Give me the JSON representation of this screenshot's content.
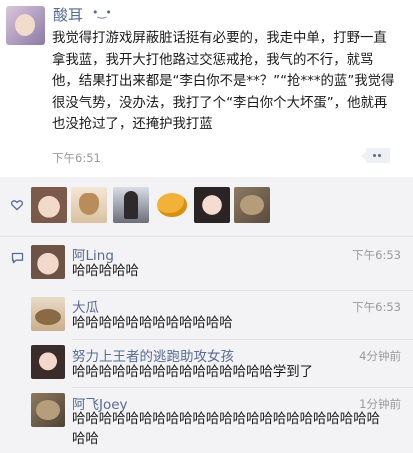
{
  "post": {
    "author": "酸耳",
    "author_decoration": "•‿•",
    "text": "我觉得打游戏屏蔽脏话挺有必要的，我走中单，打野一直拿我蓝，我开大打他路过交惩戒抢，我气的不行，就骂他，结果打出来都是“李白你不是**？”“抢***的蓝”我觉得很没气势，没办法，我打了个“李白你个大坏蛋”，他就再也没抢过了，还掩护我打蓝",
    "time": "下午6:51",
    "more_icon": "more-dots-icon"
  },
  "likes": {
    "icon": "heart-icon",
    "avatars": [
      "avatar-1",
      "avatar-2",
      "avatar-3",
      "avatar-4",
      "avatar-5",
      "avatar-6"
    ]
  },
  "comments_icon": "comment-icon",
  "comments": [
    {
      "name": "阿Ling",
      "time": "下午6:53",
      "text": "哈哈哈哈哈"
    },
    {
      "name": "大瓜",
      "time": "下午6:53",
      "text": "哈哈哈哈哈哈哈哈哈哈哈哈"
    },
    {
      "name": "努力上王者的逃跑助攻女孩",
      "time": "4分钟前",
      "text": "哈哈哈哈哈哈哈哈哈哈哈哈哈哈哈学到了"
    },
    {
      "name": "阿飞Joey",
      "time": "1分钟前",
      "text": "哈哈哈哈哈哈哈哈哈哈哈哈哈哈哈哈哈哈哈哈哈哈哈哈哈"
    }
  ],
  "colors": {
    "link": "#576b95",
    "meta": "#9a9a9a",
    "comment_bg": "#f3f3f5"
  }
}
